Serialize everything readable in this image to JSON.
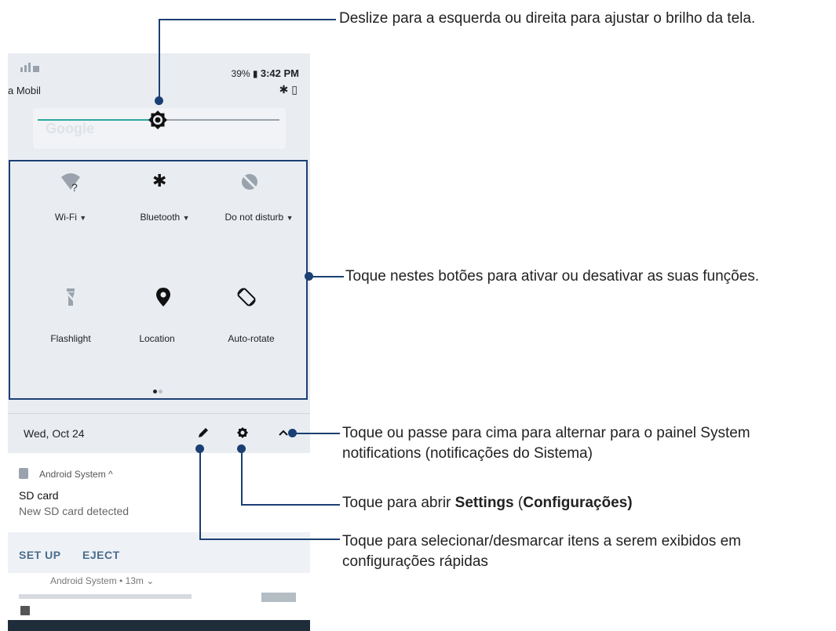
{
  "phone": {
    "status": {
      "battery": "39%",
      "time": "3:42 PM",
      "carrier": "a Mobil"
    },
    "search_ghost": "Google",
    "quick_settings": {
      "tiles": [
        {
          "label": "Wi-Fi",
          "icon": "wifi-unknown-icon",
          "has_dropdown": true
        },
        {
          "label": "Bluetooth",
          "icon": "bluetooth-icon",
          "has_dropdown": true
        },
        {
          "label": "Do not disturb",
          "icon": "do-not-disturb-icon",
          "has_dropdown": true
        },
        {
          "label": "Flashlight",
          "icon": "flashlight-off-icon",
          "has_dropdown": false
        },
        {
          "label": "Location",
          "icon": "location-icon",
          "has_dropdown": false
        },
        {
          "label": "Auto-rotate",
          "icon": "auto-rotate-icon",
          "has_dropdown": false
        }
      ],
      "page_count": 2,
      "current_page": 1
    },
    "date": "Wed, Oct 24",
    "notification": {
      "app": "Android System ^",
      "title": "SD card",
      "text": "New SD card detected",
      "actions": [
        "SET UP",
        "EJECT"
      ],
      "next_app": "Android System • 13m ⌄"
    }
  },
  "callouts": {
    "brightness": "Deslize para a esquerda ou direita para ajustar o brilho da tela.",
    "toggles": "Toque nestes botões para ativar ou desativar as suas funções.",
    "switch_line1": "Toque ou passe para cima para alternar para o painel System",
    "switch_line2": "notifications (notificações do Sistema)",
    "settings_prefix": "Toque para abrir ",
    "settings_bold": "Settings",
    "settings_paren_open": " (",
    "settings_bold2": "Configurações)",
    "edit_line1": "Toque para selecionar/desmarcar itens a serem exibidos em",
    "edit_line2": "configurações rápidas"
  },
  "colors": {
    "accent": "#1b3f73",
    "slider": "#2aa9a0",
    "panel": "#e9edf2"
  }
}
